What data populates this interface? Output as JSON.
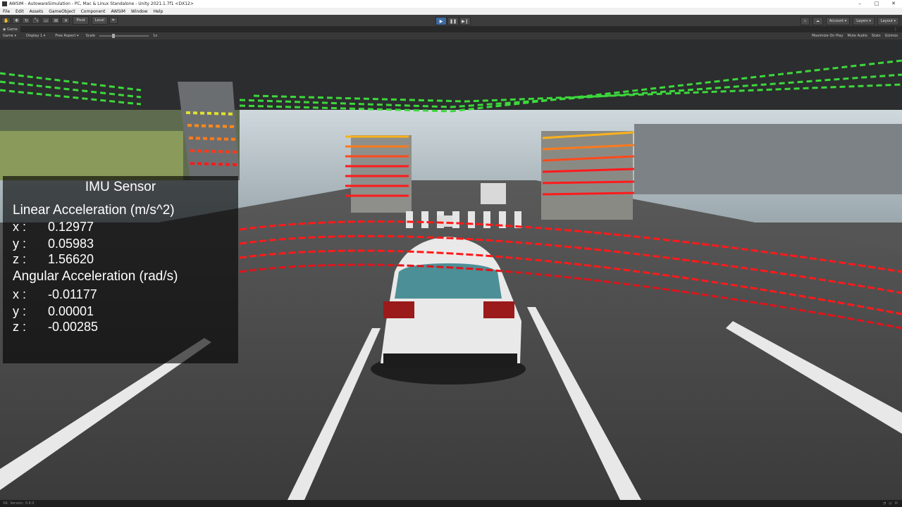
{
  "window": {
    "title": "AWSIM - AutowareSimulation - PC, Mac & Linux Standalone - Unity 2021.1.7f1 <DX12>",
    "minimize_glyph": "–",
    "maximize_glyph": "□",
    "close_glyph": "✕"
  },
  "menu": [
    "File",
    "Edit",
    "Assets",
    "GameObject",
    "Component",
    "AWSIM",
    "Window",
    "Help"
  ],
  "toolbar": {
    "pivot_label": "Pivot",
    "local_label": "Local",
    "account_label": "Account",
    "layers_label": "Layers",
    "layout_label": "Layout"
  },
  "tab": {
    "label": "Game"
  },
  "gamebar": {
    "view_mode": "Game",
    "display": "Display 1",
    "aspect": "Free Aspect",
    "scale_label": "Scale",
    "scale_value": "1x",
    "maximize": "Maximize On Play",
    "mute": "Mute Audio",
    "stats": "Stats",
    "gizmos": "Gizmos"
  },
  "imu": {
    "title": "IMU Sensor",
    "linear_label": "Linear Acceleration (m/s^2)",
    "linear": [
      {
        "axis": "x :",
        "value": "0.12977"
      },
      {
        "axis": "y :",
        "value": "0.05983"
      },
      {
        "axis": "z :",
        "value": "1.56620"
      }
    ],
    "angular_label": "Angular Acceleration (rad/s)",
    "angular": [
      {
        "axis": "x :",
        "value": "-0.01177"
      },
      {
        "axis": "y :",
        "value": "0.00001"
      },
      {
        "axis": "z :",
        "value": "-0.00285"
      }
    ]
  },
  "status": {
    "version": "XR, Version: 0.8.0"
  },
  "colors": {
    "lidar_near": "#ff1a1a",
    "lidar_mid": "#ff7a1a",
    "lidar_far": "#3cd83c",
    "play_active": "#3d6aa0"
  }
}
